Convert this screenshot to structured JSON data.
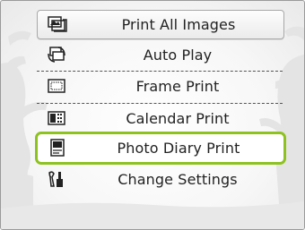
{
  "menu": {
    "items": [
      {
        "label": "Print All Images",
        "icon": "print-all-images-icon"
      },
      {
        "label": "Auto Play",
        "icon": "auto-play-icon"
      },
      {
        "label": "Frame Print",
        "icon": "frame-print-icon"
      },
      {
        "label": "Calendar Print",
        "icon": "calendar-print-icon"
      },
      {
        "label": "Photo Diary Print",
        "icon": "photo-diary-print-icon"
      },
      {
        "label": "Change Settings",
        "icon": "change-settings-icon"
      }
    ],
    "selected_index": 4
  },
  "colors": {
    "selection_border": "#8dc21f",
    "background": "#f7f7f7",
    "tree_silhouette": "#e3e3e3"
  }
}
